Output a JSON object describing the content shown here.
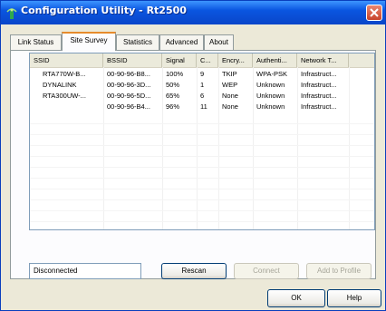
{
  "window": {
    "title": "Configuration Utility - Rt2500"
  },
  "tabs": [
    {
      "label": "Link Status",
      "active": false
    },
    {
      "label": "Site Survey",
      "active": true
    },
    {
      "label": "Statistics",
      "active": false
    },
    {
      "label": "Advanced",
      "active": false
    },
    {
      "label": "About",
      "active": false
    }
  ],
  "site_survey": {
    "columns": [
      "SSID",
      "BSSID",
      "Signal",
      "C...",
      "Encry...",
      "Authenti...",
      "Network T..."
    ],
    "rows": [
      [
        "RTA770W-B...",
        "00-90-96-B8...",
        "100%",
        "9",
        "TKIP",
        "WPA-PSK",
        "Infrastruct..."
      ],
      [
        "DYNALINK",
        "00-90-96-3D...",
        "50%",
        "1",
        "WEP",
        "Unknown",
        "Infrastruct..."
      ],
      [
        "RTA300UW-...",
        "00-90-96-5D...",
        "65%",
        "6",
        "None",
        "Unknown",
        "Infrastruct..."
      ],
      [
        "",
        "00-90-96-B4...",
        "96%",
        "11",
        "None",
        "Unknown",
        "Infrastruct..."
      ]
    ],
    "status": "Disconnected",
    "buttons": {
      "rescan": "Rescan",
      "connect": "Connect",
      "add_to_profile": "Add to Profile"
    }
  },
  "footer": {
    "ok": "OK",
    "help": "Help"
  },
  "colors": {
    "titlebar": "#0a55e0",
    "active_tab_accent": "#e68b2c",
    "close_button": "#c8432a"
  },
  "icons": {
    "app": "wireless-signal-icon",
    "close": "close-icon"
  }
}
